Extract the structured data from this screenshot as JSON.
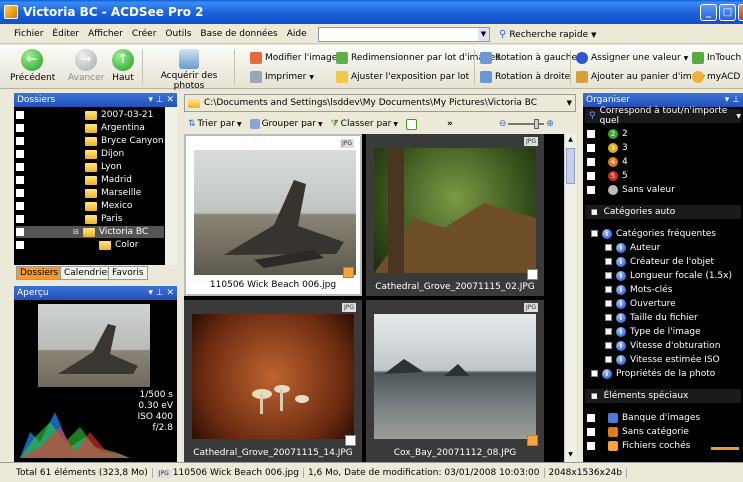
{
  "window": {
    "title": "Victoria BC - ACDSee Pro 2"
  },
  "menu": [
    "Fichier",
    "Éditer",
    "Afficher",
    "Créer",
    "Outils",
    "Base de données",
    "Aide"
  ],
  "quick_search": {
    "label": "Recherche rapide"
  },
  "toolbar": {
    "back": "Précédent",
    "forward": "Avancer",
    "up": "Haut",
    "acquire": "Acquérir des photos",
    "edit_image": "Modifier l'image",
    "batch_resize": "Redimensionner par lot d'images",
    "rotate_left": "Rotation à gauche",
    "assign_value": "Assigner une valeur",
    "intouch": "InTouch",
    "print": "Imprimer",
    "adjust_exposure": "Ajuster l'exposition par lot",
    "rotate_right": "Rotation à droite",
    "add_basket": "Ajouter au panier d'ima",
    "myacd": "myACD"
  },
  "folders_panel": {
    "title": "Dossiers",
    "items": [
      "2007-03-21",
      "Argentina",
      "Bryce Canyon",
      "Dijon",
      "Lyon",
      "Madrid",
      "Marseille",
      "Mexico",
      "Paris",
      "Victoria BC",
      "Color"
    ],
    "tabs": [
      "Dossiers",
      "Calendrier",
      "Favoris"
    ]
  },
  "preview_panel": {
    "title": "Aperçu",
    "shutter": "1/500 s",
    "ev": "0.30 eV",
    "iso": "ISO 400",
    "aperture": "f/2.8"
  },
  "path": "C:\\Documents and Settings\\lsddev\\My Documents\\My Pictures\\Victoria BC",
  "sortbar": {
    "sort": "Trier par",
    "group": "Grouper par",
    "filter": "Classer par"
  },
  "thumbnails": [
    {
      "name": "110506 Wick Beach 006.jpg",
      "selected": true,
      "checked": true
    },
    {
      "name": "Cathedral_Grove_20071115_02.JPG",
      "selected": false,
      "checked": false
    },
    {
      "name": "Cathedral_Grove_20071115_14.JPG",
      "selected": false,
      "checked": false
    },
    {
      "name": "Cox_Bay_20071112_08.JPG",
      "selected": false,
      "checked": true
    }
  ],
  "organiser": {
    "title": "Organiser",
    "match": "Correspond à tout/n'importe quel",
    "ratings": [
      "2",
      "3",
      "4",
      "5",
      "Sans valeur"
    ],
    "auto_categories": "Catégories auto",
    "frequent": "Catégories fréquentes",
    "frequent_items": [
      "Auteur",
      "Créateur de l'objet",
      "Longueur focale (1.5x)",
      "Mots-clés",
      "Ouverture",
      "Taille du fichier",
      "Type de l'image",
      "Vitesse d'obturation",
      "Vitesse estimée ISO"
    ],
    "photo_props": "Propriétés de la photo",
    "special": "Éléments spéciaux",
    "special_items": [
      "Banque d'images",
      "Sans catégorie",
      "Fichiers cochés"
    ]
  },
  "status": {
    "total": "Total 61 éléments  (323,8 Mo)",
    "file": "110506 Wick Beach 006.jpg",
    "info": "1,6 Mo, Date de modification: 03/01/2008 10:03:00",
    "dims": "2048x1536x24b"
  },
  "colors": {
    "title_blue": "#1d64de",
    "panel_blue": "#2150b8",
    "tab_orange": "#f49928"
  }
}
